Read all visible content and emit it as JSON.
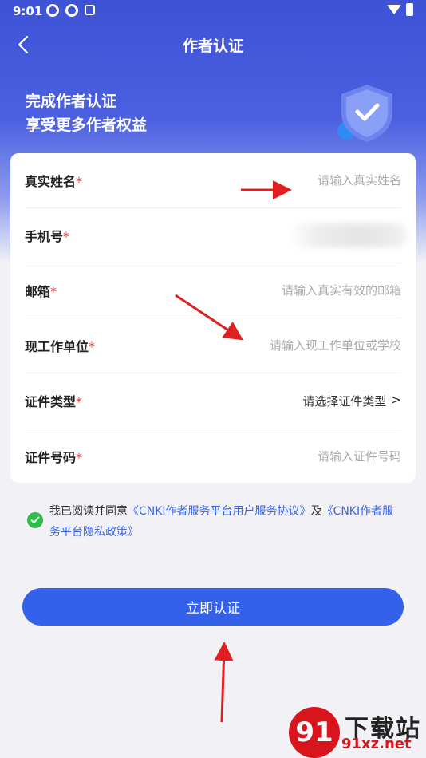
{
  "status_bar": {
    "time": "9:01"
  },
  "nav": {
    "title": "作者认证"
  },
  "hero": {
    "line1": "完成作者认证",
    "line2": "享受更多作者权益"
  },
  "form": {
    "rows": [
      {
        "label": "真实姓名",
        "required": "*",
        "placeholder": "请输入真实姓名"
      },
      {
        "label": "手机号",
        "required": "*"
      },
      {
        "label": "邮箱",
        "required": "*",
        "placeholder": "请输入真实有效的邮箱"
      },
      {
        "label": "现工作单位",
        "required": "*",
        "placeholder": "请输入现工作单位或学校"
      },
      {
        "label": "证件类型",
        "required": "*",
        "select_value": "请选择证件类型",
        "chevron": ">"
      },
      {
        "label": "证件号码",
        "required": "*",
        "placeholder": "请输入证件号码"
      }
    ]
  },
  "agreement": {
    "prefix": "我已阅读并同意",
    "link1": "《CNKI作者服务平台用户服务协议》",
    "conjunction": "及",
    "link2": "《CNKI作者服务平台隐私政策》"
  },
  "submit": {
    "label": "立即认证"
  },
  "watermark": {
    "logo": "91",
    "title": "下载站",
    "site": "91xz.net"
  },
  "colors": {
    "primary": "#3461ea",
    "header": "#3e52d6",
    "required": "#e23c3c",
    "check": "#2dbb4a",
    "annotation_arrow": "#e02020"
  }
}
